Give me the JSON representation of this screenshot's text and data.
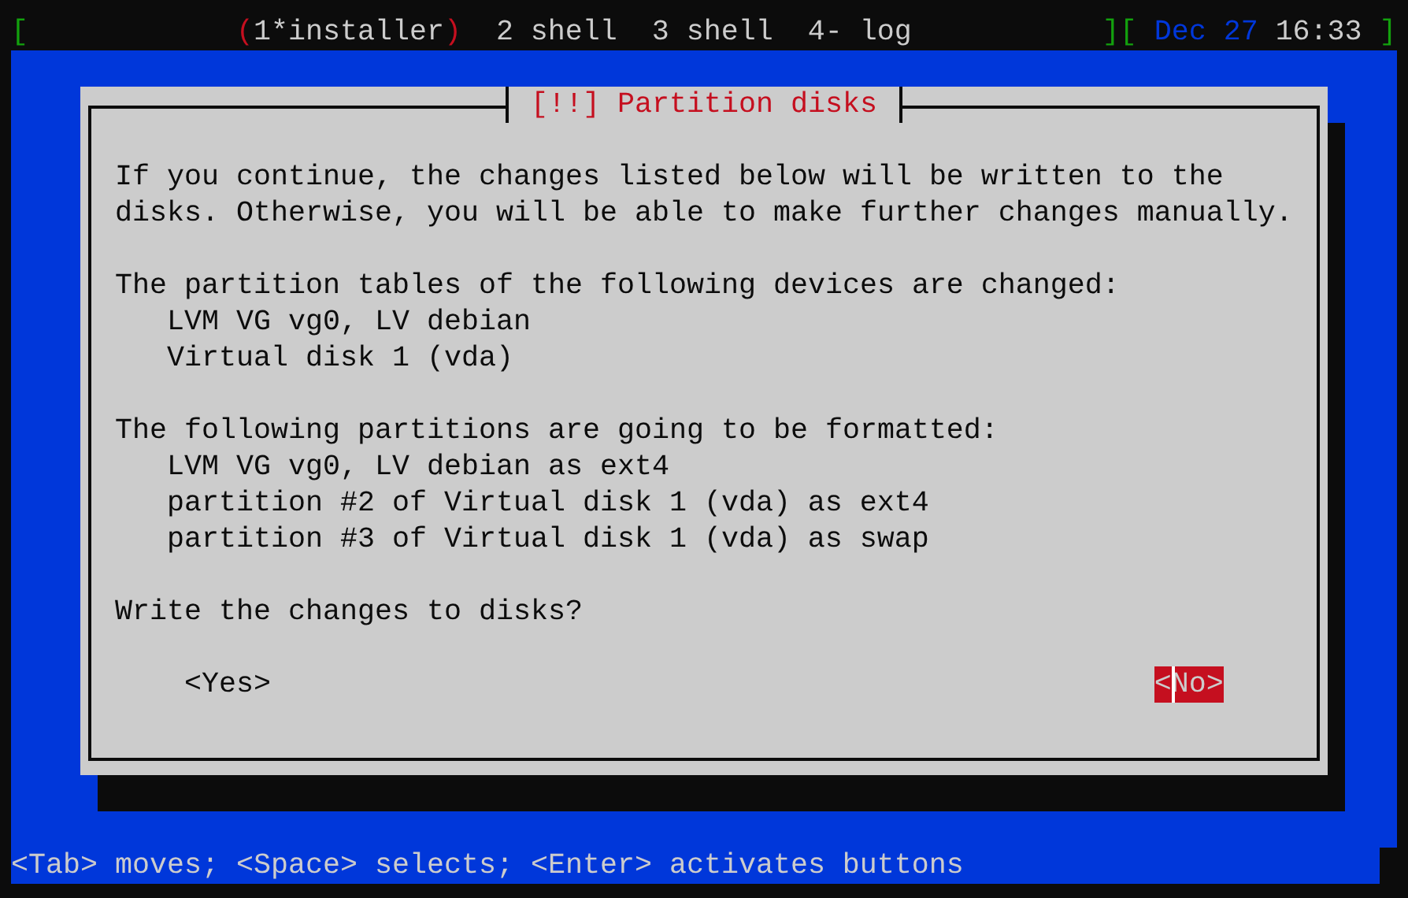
{
  "top_bar": {
    "brackets": {
      "left": "[",
      "middle": "][",
      "right": "]"
    },
    "selected_marks": [
      "(",
      ")"
    ],
    "windows": [
      {
        "label": "1*installer",
        "selected": true
      },
      {
        "label": "2 shell",
        "selected": false
      },
      {
        "label": "3 shell",
        "selected": false
      },
      {
        "label": "4- log",
        "selected": false
      }
    ],
    "date": "Dec 27",
    "time": "16:33"
  },
  "dialog": {
    "title": "[!!] Partition disks",
    "paragraphs": [
      {
        "lines": [
          {
            "kind": "text",
            "text": "If you continue, the changes listed below will be written to the disks. Otherwise, you will be able to make further changes manually."
          }
        ]
      },
      {
        "lines": [
          {
            "kind": "text",
            "text": "The partition tables of the following devices are changed:"
          },
          {
            "kind": "item",
            "text": "LVM VG vg0, LV debian"
          },
          {
            "kind": "item",
            "text": "Virtual disk 1 (vda)"
          }
        ]
      },
      {
        "lines": [
          {
            "kind": "text",
            "text": "The following partitions are going to be formatted:"
          },
          {
            "kind": "item",
            "text": "LVM VG vg0, LV debian as ext4"
          },
          {
            "kind": "item",
            "text": "partition #2 of Virtual disk 1 (vda) as ext4"
          },
          {
            "kind": "item",
            "text": "partition #3 of Virtual disk 1 (vda) as swap"
          }
        ]
      },
      {
        "lines": [
          {
            "kind": "text",
            "text": "Write the changes to disks?"
          }
        ]
      }
    ],
    "buttons": [
      {
        "label": "<Yes>",
        "selected": false
      },
      {
        "label": "<No>",
        "selected": true
      }
    ]
  },
  "status_bar": "<Tab> moves; <Space> selects; <Enter> activates buttons"
}
